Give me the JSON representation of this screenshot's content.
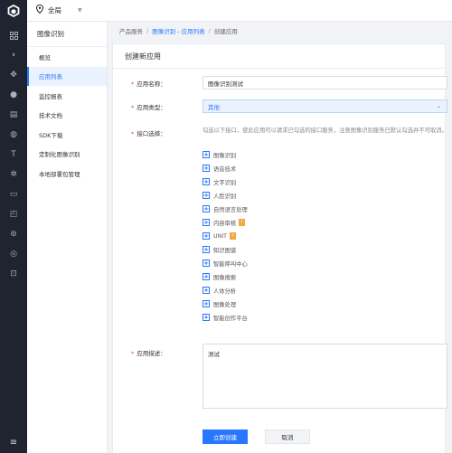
{
  "topbar": {
    "region": "全局"
  },
  "sidebar": {
    "title": "图像识别",
    "items": [
      "概览",
      "应用列表",
      "监控报表",
      "技术文档",
      "SDK下载",
      "定制化图像识别",
      "本地部署包管理"
    ]
  },
  "breadcrumb": {
    "root": "产品服务",
    "sep": "/",
    "parent": "图像识别 - 应用列表",
    "current": "创建应用"
  },
  "form": {
    "title": "创建新应用",
    "name_label": "应用名称：",
    "name_value": "图像识别测试",
    "type_label": "应用类型：",
    "type_value": "其他",
    "api_label": "接口选择：",
    "api_hint": "勾选以下接口，使此应用可以请求已勾选的接口服务，注意图像识别服务已默认勾选并不可取消。",
    "apis": [
      "图像识别",
      "语音技术",
      "文字识别",
      "人脸识别",
      "自然语言处理",
      "内容审核",
      "UNIT",
      "知识图谱",
      "智能呼叫中心",
      "图像搜索",
      "人体分析",
      "图像处理",
      "智能创作平台"
    ],
    "badge_text": "!",
    "desc_label": "应用描述：",
    "desc_value": "测试",
    "required_mark": "*",
    "submit_label": "立即创建",
    "cancel_label": "取消"
  },
  "colors": {
    "accent": "#2878ff",
    "rail": "#1f2430",
    "badge": "#f4a742"
  }
}
